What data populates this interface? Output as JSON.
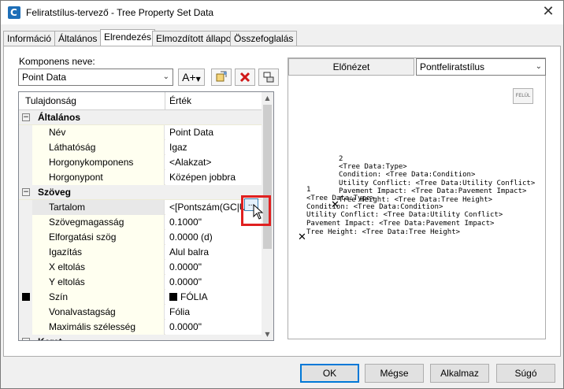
{
  "window": {
    "title": "Feliratstílus-tervező - Tree Property Set Data",
    "close": "✕",
    "app_icon_letter": "C"
  },
  "tabs": [
    "Információ",
    "Általános",
    "Elrendezés",
    "Elmozdított állapot",
    "Összefoglalás"
  ],
  "active_tab": "Elrendezés",
  "component": {
    "label": "Komponens neve:",
    "value": "Point Data"
  },
  "toolbar": {
    "text_button": "A+",
    "icons": [
      "create-text-component-icon",
      "copy-component-icon",
      "delete-component-icon",
      "draw-order-icon"
    ]
  },
  "grid": {
    "col_property": "Tulajdonság",
    "col_value": "Érték",
    "rows": [
      {
        "type": "cat",
        "name": "Általános",
        "toggle": "−"
      },
      {
        "type": "prop",
        "name": "Név",
        "value": "Point Data"
      },
      {
        "type": "prop",
        "name": "Láthatóság",
        "value": "Igaz"
      },
      {
        "type": "prop",
        "name": "Horgonykomponens",
        "value": "<Alakzat>"
      },
      {
        "type": "prop",
        "name": "Horgonypont",
        "value": "Középen jobbra"
      },
      {
        "type": "cat",
        "name": "Szöveg",
        "toggle": "−"
      },
      {
        "type": "prop",
        "name": "Tartalom",
        "value": "<[Pontszám(GC|U",
        "selected": true
      },
      {
        "type": "prop",
        "name": "Szövegmagasság",
        "value": "0.1000\""
      },
      {
        "type": "prop",
        "name": "Elforgatási szög",
        "value": "0.0000 (d)"
      },
      {
        "type": "prop",
        "name": "Igazítás",
        "value": "Alul balra"
      },
      {
        "type": "prop",
        "name": "X eltolás",
        "value": "0.0000\""
      },
      {
        "type": "prop",
        "name": "Y eltolás",
        "value": "0.0000\""
      },
      {
        "type": "prop",
        "name": "Szín",
        "value": "FÓLIA",
        "swatch": "#000000"
      },
      {
        "type": "prop",
        "name": "Vonalvastagság",
        "value": "Fólia"
      },
      {
        "type": "prop",
        "name": "Maximális szélesség",
        "value": "0.0000\""
      },
      {
        "type": "cat",
        "name": "Keret",
        "toggle": "−"
      }
    ],
    "ellipsis": "..."
  },
  "preview": {
    "tab": "Előnézet",
    "style_select": "Pontfeliratstílus",
    "view_cube": "FELÜL",
    "lines_a": [
      "2",
      "<Tree Data:Type>",
      "Condition: <Tree Data:Condition>",
      "Utility Conflict: <Tree Data:Utility Conflict>",
      "Pavement Impact: <Tree Data:Pavement Impact>",
      "Tree Height: <Tree Data:Tree Height>"
    ],
    "lines_b": [
      "1",
      "<Tree Data:Type>",
      "Condition: <Tree Data:Condition>",
      "Utility Conflict: <Tree Data:Utility Conflict>",
      "Pavement Impact: <Tree Data:Pavement Impact>",
      "Tree Height: <Tree Data:Tree Height>"
    ],
    "point_marker": "✕"
  },
  "buttons": {
    "ok": "OK",
    "cancel": "Mégse",
    "apply": "Alkalmaz",
    "help": "Súgó"
  }
}
